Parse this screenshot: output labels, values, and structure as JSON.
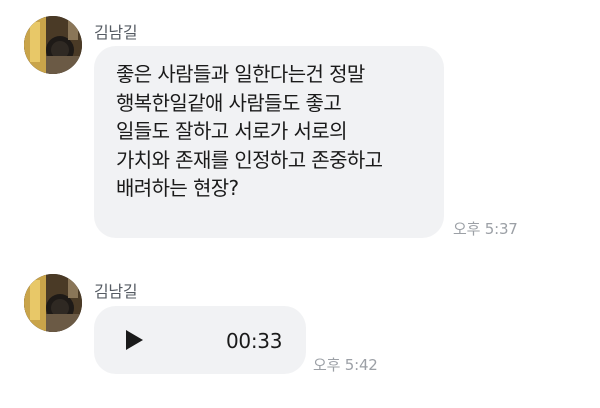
{
  "messages": [
    {
      "sender": "김남길",
      "type": "text",
      "lines": [
        "좋은 사람들과 일한다는건 정말",
        "행복한일같애 사람들도 좋고",
        "일들도 잘하고 서로가 서로의",
        "가치와 존재를 인정하고 존중하고",
        "배려하는 현장?"
      ],
      "time": "오후 5:37"
    },
    {
      "sender": "김남길",
      "type": "voice",
      "play_icon": "play-icon",
      "duration": "00:33",
      "time": "오후 5:42"
    }
  ],
  "colors": {
    "bubble": "#f1f2f4",
    "text": "#1a1a1a",
    "sender": "#555b63",
    "time": "#9ca0a6"
  }
}
